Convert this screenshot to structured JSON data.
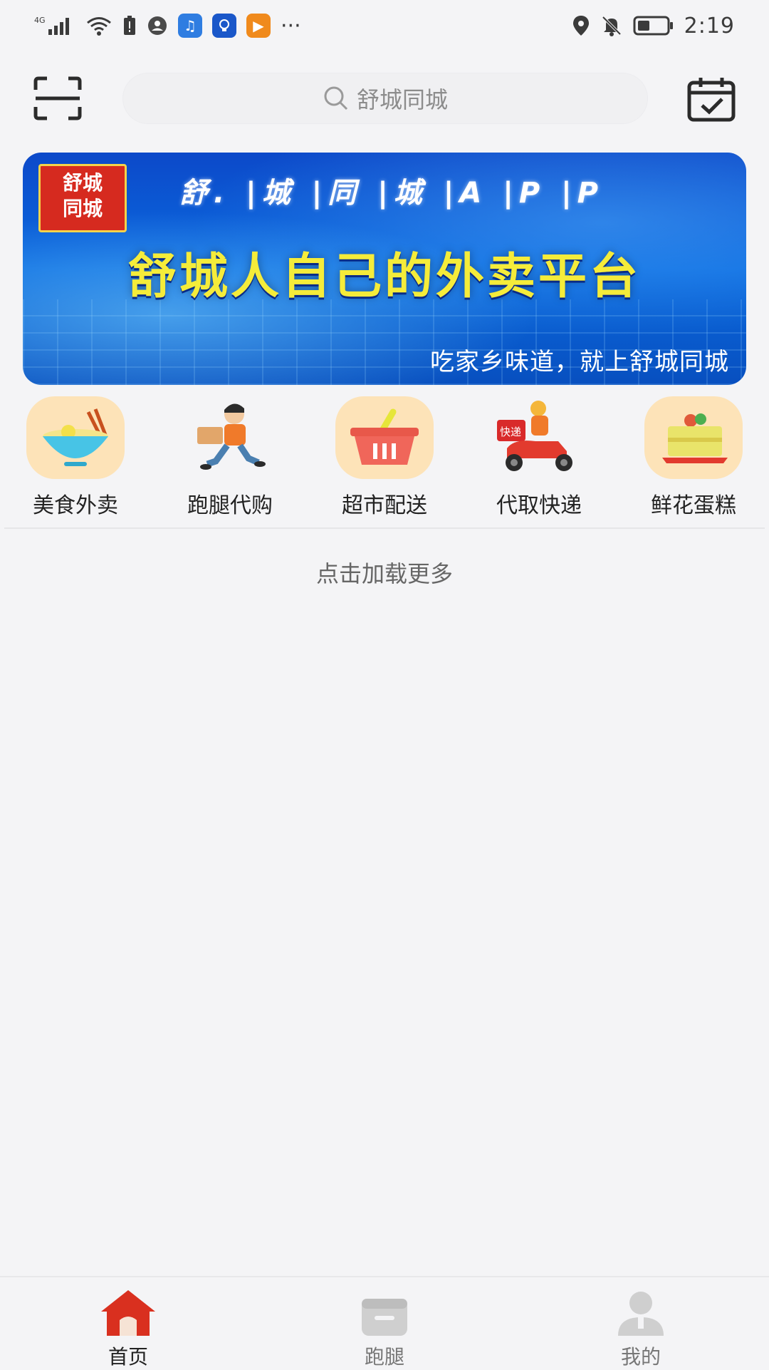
{
  "status_bar": {
    "network": "4G",
    "time": "2:19",
    "more": "···"
  },
  "search": {
    "placeholder": "舒城同城"
  },
  "banner": {
    "logo_line1": "舒城",
    "logo_line2": "同城",
    "tagline_top": "舒. |城 |同 |城 |A |P |P",
    "headline": "舒城人自己的外卖平台",
    "subtitle": "吃家乡味道，就上舒城同城"
  },
  "categories": [
    {
      "label": "美食外卖",
      "icon": "noodle-bowl-icon"
    },
    {
      "label": "跑腿代购",
      "icon": "runner-icon"
    },
    {
      "label": "超市配送",
      "icon": "basket-icon"
    },
    {
      "label": "代取快递",
      "icon": "delivery-scooter-icon"
    },
    {
      "label": "鲜花蛋糕",
      "icon": "cake-icon"
    }
  ],
  "delivery_badge": "快递",
  "load_more": "点击加载更多",
  "tabs": [
    {
      "label": "首页",
      "icon": "home-icon",
      "active": true
    },
    {
      "label": "跑腿",
      "icon": "errand-icon",
      "active": false
    },
    {
      "label": "我的",
      "icon": "profile-icon",
      "active": false
    }
  ],
  "colors": {
    "accent": "#d9301f",
    "banner_blue": "#0a6ae0",
    "headline_yellow": "#f5ec3a"
  }
}
